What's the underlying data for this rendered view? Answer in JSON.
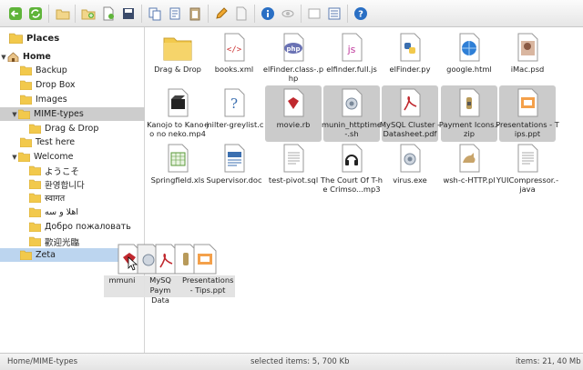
{
  "sidebar": {
    "places": "Places",
    "home": "Home",
    "folders": {
      "backup": "Backup",
      "dropbox": "Drop Box",
      "images": "Images",
      "mimetypes": "MIME-types",
      "dragdrop": "Drag & Drop",
      "testhere": "Test here",
      "welcome": "Welcome",
      "w1": "ようこそ",
      "w2": "환영합니다",
      "w3": "स्वागत",
      "w4": "اهلا و سه",
      "w5": "Добро пожаловать",
      "w6": "歡迎光臨",
      "zeta": "Zeta"
    }
  },
  "files": [
    {
      "name": "Drag & Drop"
    },
    {
      "name": "books.xml"
    },
    {
      "name": "elFinder.class-.php"
    },
    {
      "name": "elfinder.full.js"
    },
    {
      "name": "elFinder.py"
    },
    {
      "name": "google.html"
    },
    {
      "name": "iMac.psd"
    },
    {
      "name": "Kanojo to Kano-jo no neko.mp4"
    },
    {
      "name": "milter-greylist.c"
    },
    {
      "name": "movie.rb"
    },
    {
      "name": "munin_httptime-.sh"
    },
    {
      "name": "MySQL Cluster - Datasheet.pdf"
    },
    {
      "name": "Payment Icons.-zip"
    },
    {
      "name": "Presentations - Tips.ppt"
    },
    {
      "name": "Springfield.xls"
    },
    {
      "name": "Supervisor.doc"
    },
    {
      "name": "test-pivot.sql"
    },
    {
      "name": "The Court Of T-he Crimso...mp3"
    },
    {
      "name": "virus.exe"
    },
    {
      "name": "wsh-c-HTTP.pl"
    },
    {
      "name": "YUICompressor.-java"
    }
  ],
  "drag": {
    "l1": "mmuni",
    "l2": "MySQ Paym Data",
    "l3": "Presentations - Tips.ppt"
  },
  "status": {
    "path": "Home/MIME-types",
    "selected": "selected items: 5, 700 Kb",
    "items": "items: 21, 40 Mb"
  },
  "colors": {
    "folder": "#f2c94c",
    "selection": "#cbcbcb",
    "drop_target": "#bcd5ef"
  }
}
